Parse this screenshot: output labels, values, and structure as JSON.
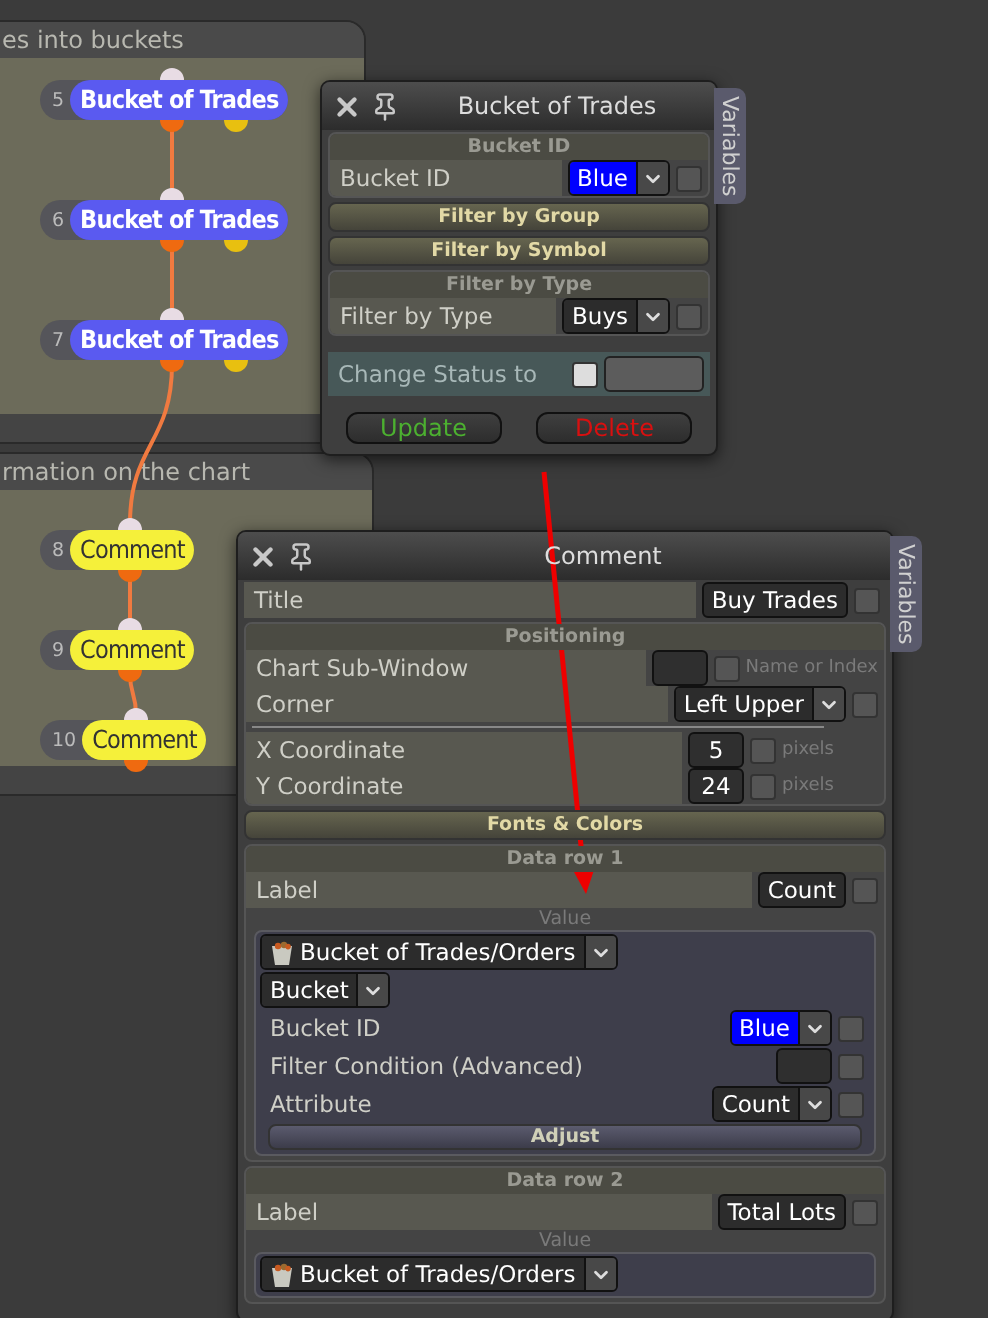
{
  "groups": [
    {
      "title": "es into buckets",
      "nodes": [
        {
          "number": "5",
          "label": "Bucket of Trades",
          "kind": "bucket"
        },
        {
          "number": "6",
          "label": "Bucket of Trades",
          "kind": "bucket"
        },
        {
          "number": "7",
          "label": "Bucket of Trades",
          "kind": "bucket"
        }
      ]
    },
    {
      "title": "rmation on the chart",
      "nodes": [
        {
          "number": "8",
          "label": "Comment",
          "kind": "comment"
        },
        {
          "number": "9",
          "label": "Comment",
          "kind": "comment"
        },
        {
          "number": "10",
          "label": "Comment",
          "kind": "comment"
        }
      ]
    }
  ],
  "bucket_window": {
    "title": "Bucket of Trades",
    "side_tab": "Variables",
    "items": [
      {
        "kind": "section",
        "title": "Bucket ID",
        "items": [
          {
            "kind": "dropdown",
            "label": "Bucket ID",
            "value": "Blue",
            "color": "#0000ff",
            "checked": false
          }
        ]
      },
      {
        "kind": "collapsed",
        "title": "Filter by Group"
      },
      {
        "kind": "collapsed",
        "title": "Filter by Symbol"
      },
      {
        "kind": "section",
        "title": "Filter by Type",
        "items": [
          {
            "kind": "dropdown",
            "label": "Filter by Type",
            "value": "Buys",
            "checked": false
          }
        ]
      },
      {
        "kind": "status",
        "label": "Change Status to",
        "checked": false
      }
    ],
    "buttons": [
      {
        "label": "Update",
        "kind": "confirm"
      },
      {
        "label": "Delete",
        "kind": "danger"
      }
    ]
  },
  "comment_window": {
    "title": "Comment",
    "side_tab": "Variables",
    "items": [
      {
        "kind": "text",
        "label": "Title",
        "value": "Buy Trades",
        "checked": false
      },
      {
        "kind": "section",
        "title": "Positioning",
        "items": [
          {
            "kind": "field",
            "label": "Chart Sub-Window",
            "checked": false,
            "hint": "Name or Index"
          },
          {
            "kind": "dropdown",
            "label": "Corner",
            "value": "Left Upper",
            "checked": false
          },
          {
            "kind": "divider"
          },
          {
            "kind": "field",
            "label": "X Coordinate",
            "value": "5",
            "checked": false,
            "hint": "pixels"
          },
          {
            "kind": "field",
            "label": "Y Coordinate",
            "value": "24",
            "checked": false,
            "hint": "pixels"
          }
        ]
      },
      {
        "kind": "collapsed",
        "title": "Fonts & Colors"
      },
      {
        "kind": "section",
        "title": "Data row 1",
        "items": [
          {
            "kind": "text",
            "label": "Label",
            "value": "Count",
            "checked": false
          },
          {
            "kind": "value",
            "caption": "Value",
            "source": "Bucket of Trades/Orders",
            "mode": "Bucket",
            "rows": [
              {
                "kind": "dropdown",
                "label": "Bucket ID",
                "value": "Blue",
                "color": "#0000ff",
                "checked": false
              },
              {
                "kind": "field",
                "label": "Filter Condition (Advanced)",
                "checked": false
              },
              {
                "kind": "dropdown",
                "label": "Attribute",
                "value": "Count",
                "checked": false
              }
            ],
            "button": "Adjust"
          }
        ]
      },
      {
        "kind": "section",
        "title": "Data row 2",
        "items": [
          {
            "kind": "text",
            "label": "Label",
            "value": "Total Lots",
            "checked": false
          },
          {
            "kind": "value",
            "caption": "Value",
            "source": "Bucket of Trades/Orders"
          }
        ]
      }
    ]
  }
}
